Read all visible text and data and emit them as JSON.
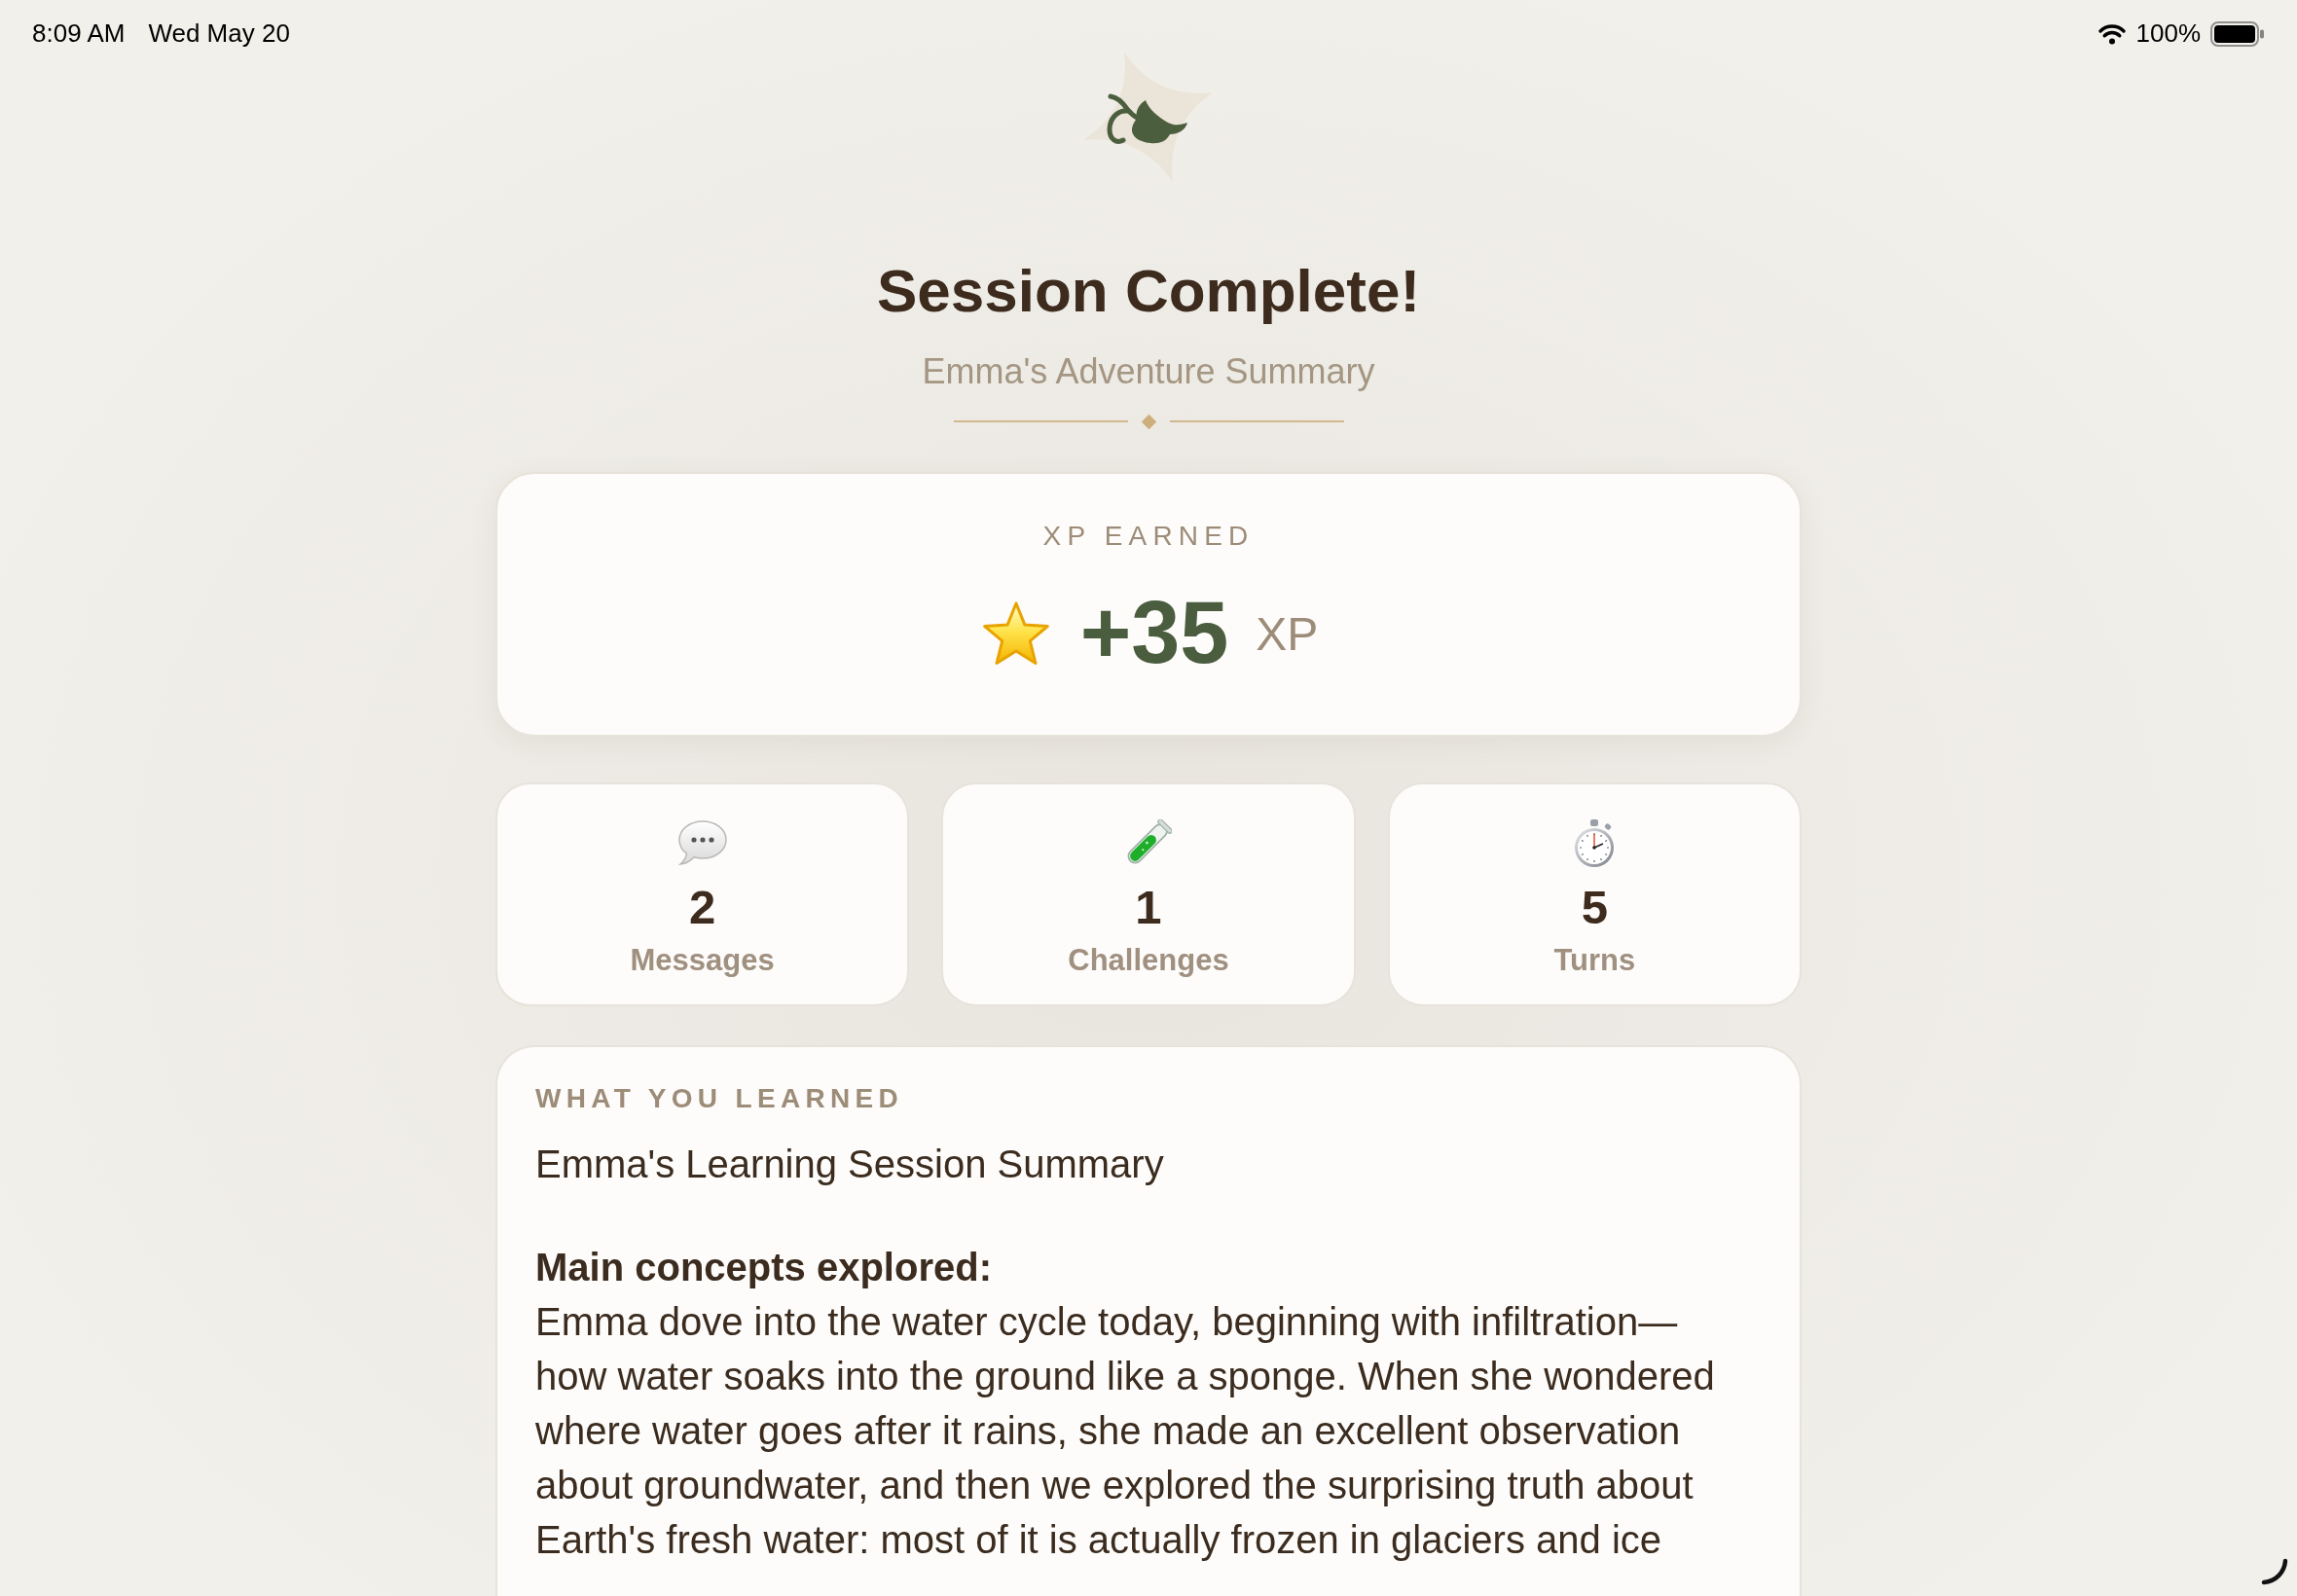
{
  "status_bar": {
    "time": "8:09 AM",
    "date": "Wed May 20",
    "battery": "100%"
  },
  "header": {
    "title": "Session Complete!",
    "subtitle": "Emma's Adventure Summary"
  },
  "xp_card": {
    "label": "XP EARNED",
    "amount": "+35",
    "unit": "XP"
  },
  "stats": [
    {
      "value": "2",
      "label": "Messages"
    },
    {
      "value": "1",
      "label": "Challenges"
    },
    {
      "value": "5",
      "label": "Turns"
    }
  ],
  "learned": {
    "label": "WHAT YOU LEARNED",
    "title": "Emma's Learning Session Summary",
    "section": "Main concepts explored:",
    "body": "Emma dove into the water cycle today, beginning with infiltration—how water soaks into the ground like a sponge. When she wondered where water goes after it rains, she made an excellent observation about groundwater, and then we explored the surprising truth about Earth's fresh water: most of it is actually frozen in glaciers and ice"
  }
}
